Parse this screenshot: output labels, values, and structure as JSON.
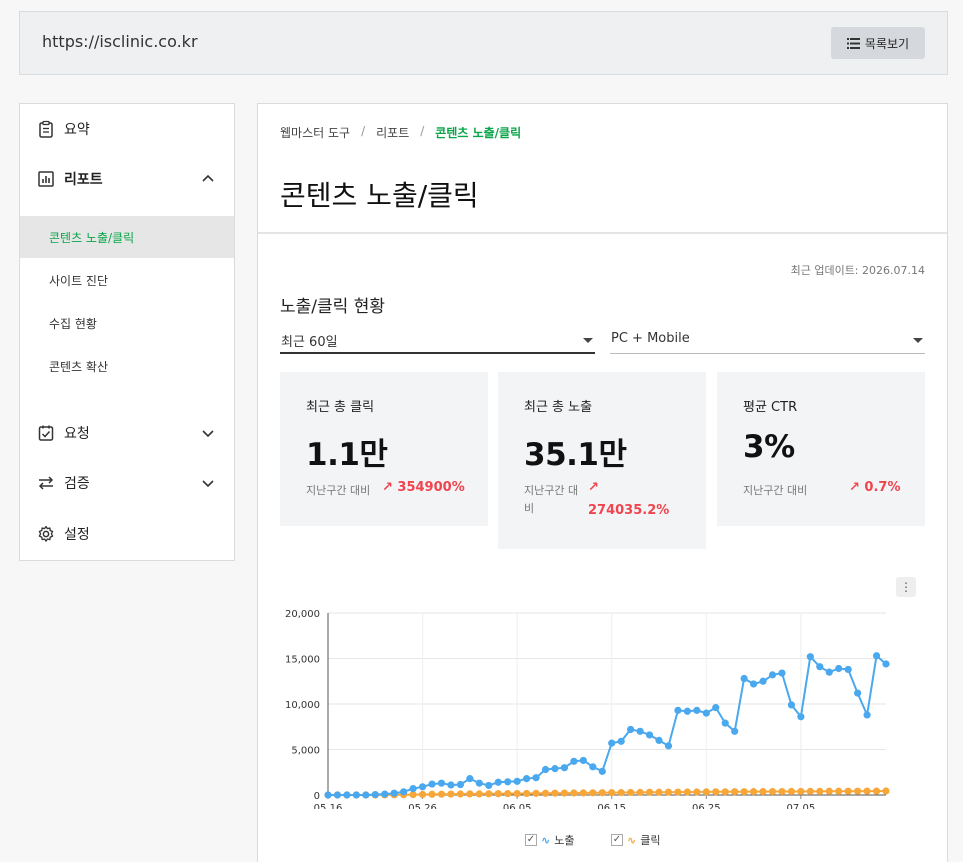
{
  "topbar": {
    "url": "https://isclinic.co.kr",
    "list_button_label": "목록보기"
  },
  "sidebar": {
    "items": [
      {
        "label": "요약"
      },
      {
        "label": "리포트"
      },
      {
        "label": "요청"
      },
      {
        "label": "검증"
      },
      {
        "label": "설정"
      }
    ],
    "report_sub": [
      {
        "label": "콘텐츠 노출/클릭"
      },
      {
        "label": "사이트 진단"
      },
      {
        "label": "수집 현황"
      },
      {
        "label": "콘텐츠 확산"
      }
    ]
  },
  "breadcrumb": {
    "items": [
      "웹마스터 도구",
      "리포트"
    ],
    "current": "콘텐츠 노출/클릭",
    "separator": "/"
  },
  "page": {
    "title": "콘텐츠 노출/클릭",
    "updated": "최근 업데이트: 2026.07.14",
    "section_title": "노출/클릭 현황"
  },
  "filters": {
    "period": "최근 60일",
    "device": "PC + Mobile"
  },
  "cards": [
    {
      "label": "최근 총 클릭",
      "value": "1.1만",
      "compare_label": "지난구간 대비",
      "delta": "354900%"
    },
    {
      "label": "최근 총 노출",
      "value": "35.1만",
      "compare_label": "지난구간 대비",
      "delta": "274035.2%"
    },
    {
      "label": "평균 CTR",
      "value": "3%",
      "compare_label": "지난구간 대비",
      "delta": "0.7%"
    }
  ],
  "colors": {
    "accent_green": "#0aa54a",
    "delta_red": "#f0444e",
    "series_impressions": "#4aa8ee",
    "series_clicks": "#f7a73a"
  },
  "chart_data": {
    "type": "line",
    "x_ticks": [
      "05.16",
      "05.26",
      "06.05",
      "06.15",
      "06.25",
      "07.05"
    ],
    "y_ticks": [
      "20,000",
      "15,000",
      "10,000",
      "5,000",
      "0"
    ],
    "ylim": [
      0,
      20000
    ],
    "grid": true,
    "legend_position": "bottom",
    "series": [
      {
        "name": "노출",
        "values": [
          0,
          0,
          0,
          0,
          0,
          50,
          100,
          200,
          350,
          700,
          900,
          1200,
          1300,
          1100,
          1150,
          1800,
          1300,
          1050,
          1400,
          1450,
          1500,
          1800,
          1900,
          2800,
          2900,
          3000,
          3700,
          3800,
          3100,
          2600,
          5700,
          5900,
          7200,
          7000,
          6600,
          6000,
          5400,
          9300,
          9200,
          9300,
          9000,
          9600,
          7900,
          7000,
          12800,
          12200,
          12500,
          13200,
          13400,
          9900,
          8600,
          15200,
          14100,
          13500,
          13900,
          13800,
          11200,
          8800,
          15300,
          14400
        ]
      },
      {
        "name": "클릭",
        "values": [
          0,
          0,
          0,
          0,
          0,
          0,
          10,
          20,
          30,
          40,
          60,
          80,
          90,
          100,
          110,
          120,
          120,
          130,
          140,
          150,
          160,
          170,
          180,
          190,
          200,
          210,
          220,
          230,
          240,
          250,
          260,
          270,
          280,
          290,
          300,
          300,
          310,
          320,
          330,
          330,
          340,
          350,
          350,
          360,
          360,
          370,
          370,
          380,
          380,
          390,
          390,
          400,
          400,
          410,
          410,
          420,
          420,
          430,
          430,
          440
        ]
      }
    ]
  }
}
